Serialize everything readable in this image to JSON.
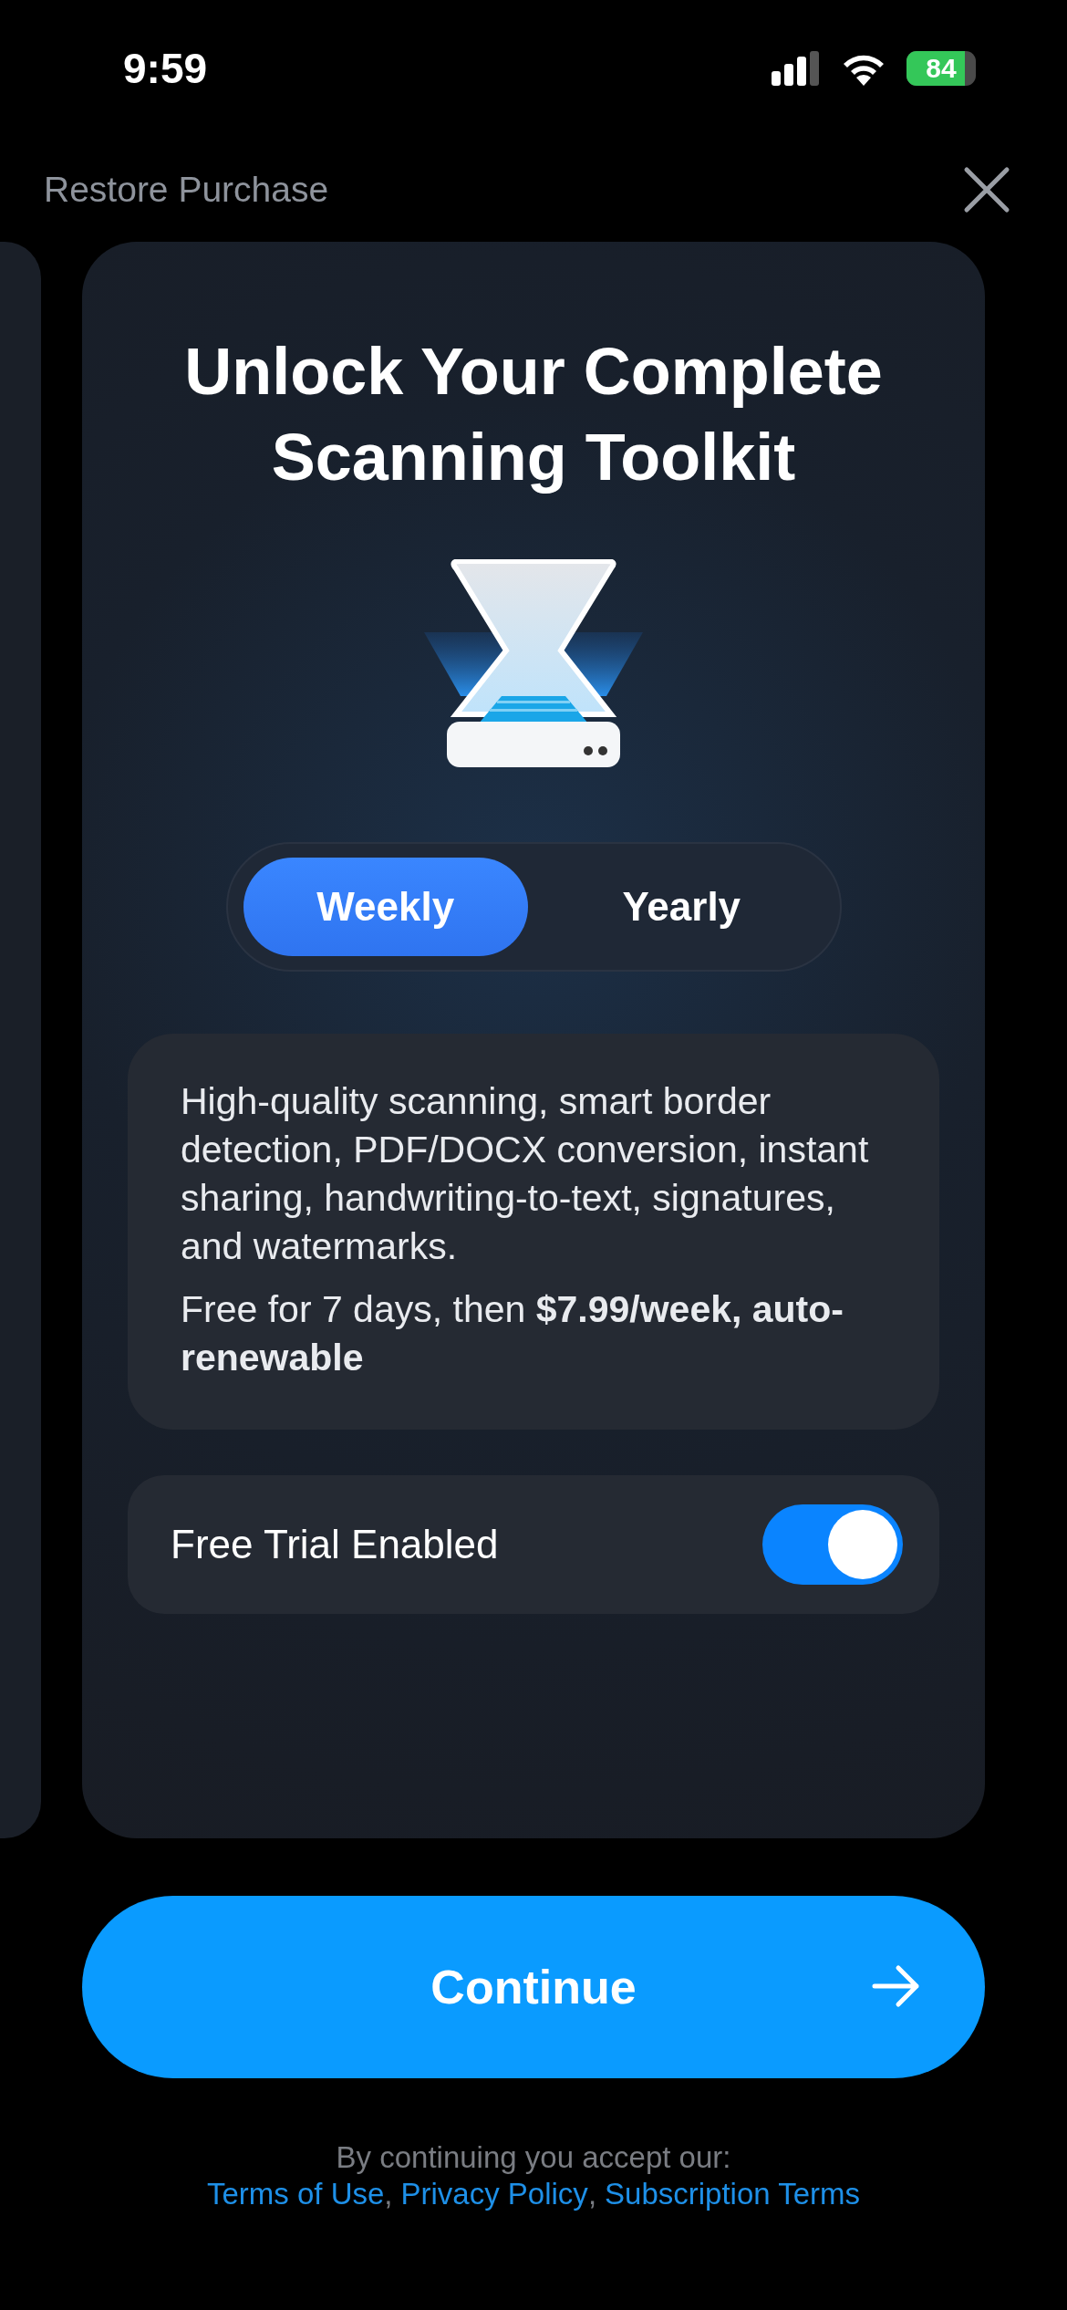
{
  "status_bar": {
    "time": "9:59",
    "battery": "84"
  },
  "header": {
    "restore": "Restore Purchase"
  },
  "card": {
    "title": "Unlock Your Complete Scanning Toolkit",
    "plans": [
      {
        "label": "Weekly",
        "selected": true
      },
      {
        "label": "Yearly",
        "selected": false
      }
    ],
    "description": [
      "High-quality scanning, smart border detection, PDF/DOCX conversion, instant sharing, handwriting-to-text, signatures, and watermarks.",
      "Free for 7 days, then **$7.99/week, auto-renewable**"
    ],
    "trial": {
      "label": "Free Trial Enabled",
      "on": true
    }
  },
  "continue_button": {
    "label": "Continue"
  },
  "footer": {
    "text": "By continuing you accept our:",
    "separator": ",",
    "links": [
      "Terms of Use",
      "Privacy Policy",
      "Subscription Terms"
    ]
  }
}
